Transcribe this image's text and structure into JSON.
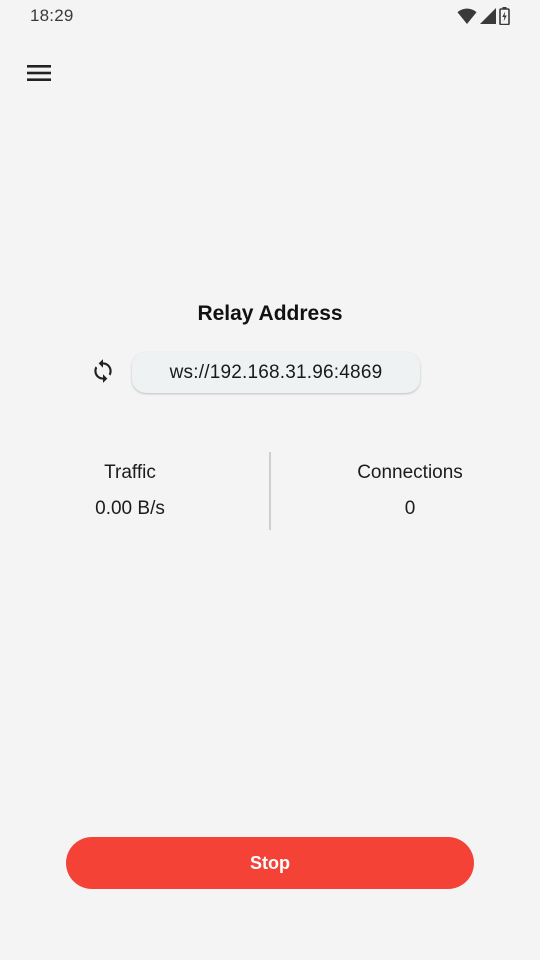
{
  "status_bar": {
    "time": "18:29",
    "icons": [
      "wifi-icon",
      "cellular-signal-icon",
      "battery-charging-icon"
    ]
  },
  "app_bar": {
    "menu_icon": "menu-icon"
  },
  "relay": {
    "title": "Relay Address",
    "refresh_icon": "refresh-icon",
    "address": "ws://192.168.31.96:4869"
  },
  "stats": {
    "traffic_label": "Traffic",
    "traffic_value": "0.00 B/s",
    "connections_label": "Connections",
    "connections_value": "0"
  },
  "actions": {
    "stop_label": "Stop"
  },
  "colors": {
    "background": "#f4f4f4",
    "accent": "#f44336",
    "chip_background": "#eef2f3"
  }
}
